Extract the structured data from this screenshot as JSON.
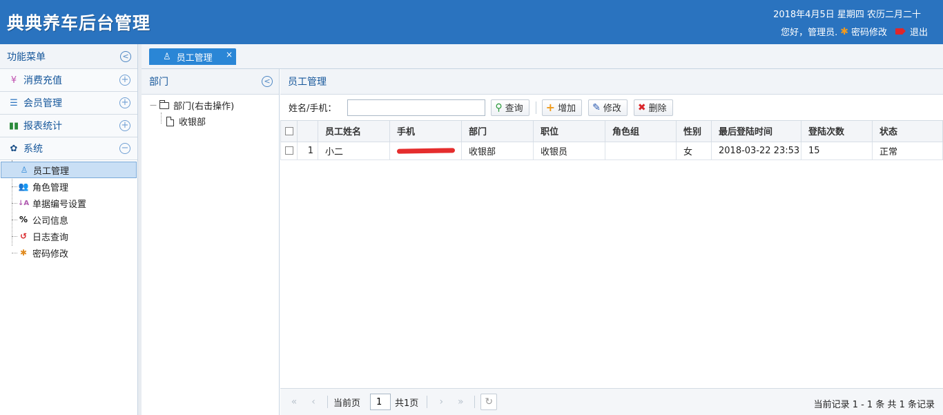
{
  "header": {
    "title": "典典养车后台管理",
    "date": "2018年4月5日 星期四 农历二月二十",
    "greeting": "您好，管理员.",
    "change_password": "密码修改",
    "logout": "退出"
  },
  "sidebar": {
    "title": "功能菜单",
    "sections": [
      {
        "label": "消费充值",
        "icon": "yen-icon"
      },
      {
        "label": "会员管理",
        "icon": "list-icon"
      },
      {
        "label": "报表统计",
        "icon": "bar-chart-icon"
      },
      {
        "label": "系统",
        "icon": "gear-icon"
      }
    ],
    "items": [
      {
        "label": "员工管理"
      },
      {
        "label": "角色管理"
      },
      {
        "label": "单据编号设置"
      },
      {
        "label": "公司信息"
      },
      {
        "label": "日志查询"
      },
      {
        "label": "密码修改"
      }
    ]
  },
  "tabs": [
    {
      "label": "员工管理"
    }
  ],
  "dept_panel": {
    "title": "部门",
    "root": "部门(右击操作)",
    "child": "收银部"
  },
  "grid_panel": {
    "title": "员工管理",
    "search_label": "姓名/手机：",
    "search_value": "",
    "buttons": {
      "query": "查询",
      "add": "增加",
      "edit": "修改",
      "delete": "删除"
    },
    "columns": [
      "员工姓名",
      "手机",
      "部门",
      "职位",
      "角色组",
      "性别",
      "最后登陆时间",
      "登陆次数",
      "状态"
    ],
    "rows": [
      {
        "num": "1",
        "name": "小二",
        "dept": "收银部",
        "position": "收银员",
        "role": "",
        "gender": "女",
        "last_login": "2018-03-22 23:53",
        "login_count": "15",
        "status": "正常"
      }
    ]
  },
  "pager": {
    "current_label": "当前页",
    "page": "1",
    "total": "共1页",
    "info": "当前记录 1 - 1 条 共 1 条记录"
  },
  "colors": {
    "header_bg": "#2a73bf",
    "tab_bg": "#2a86d6",
    "accent_text": "#15569a"
  }
}
